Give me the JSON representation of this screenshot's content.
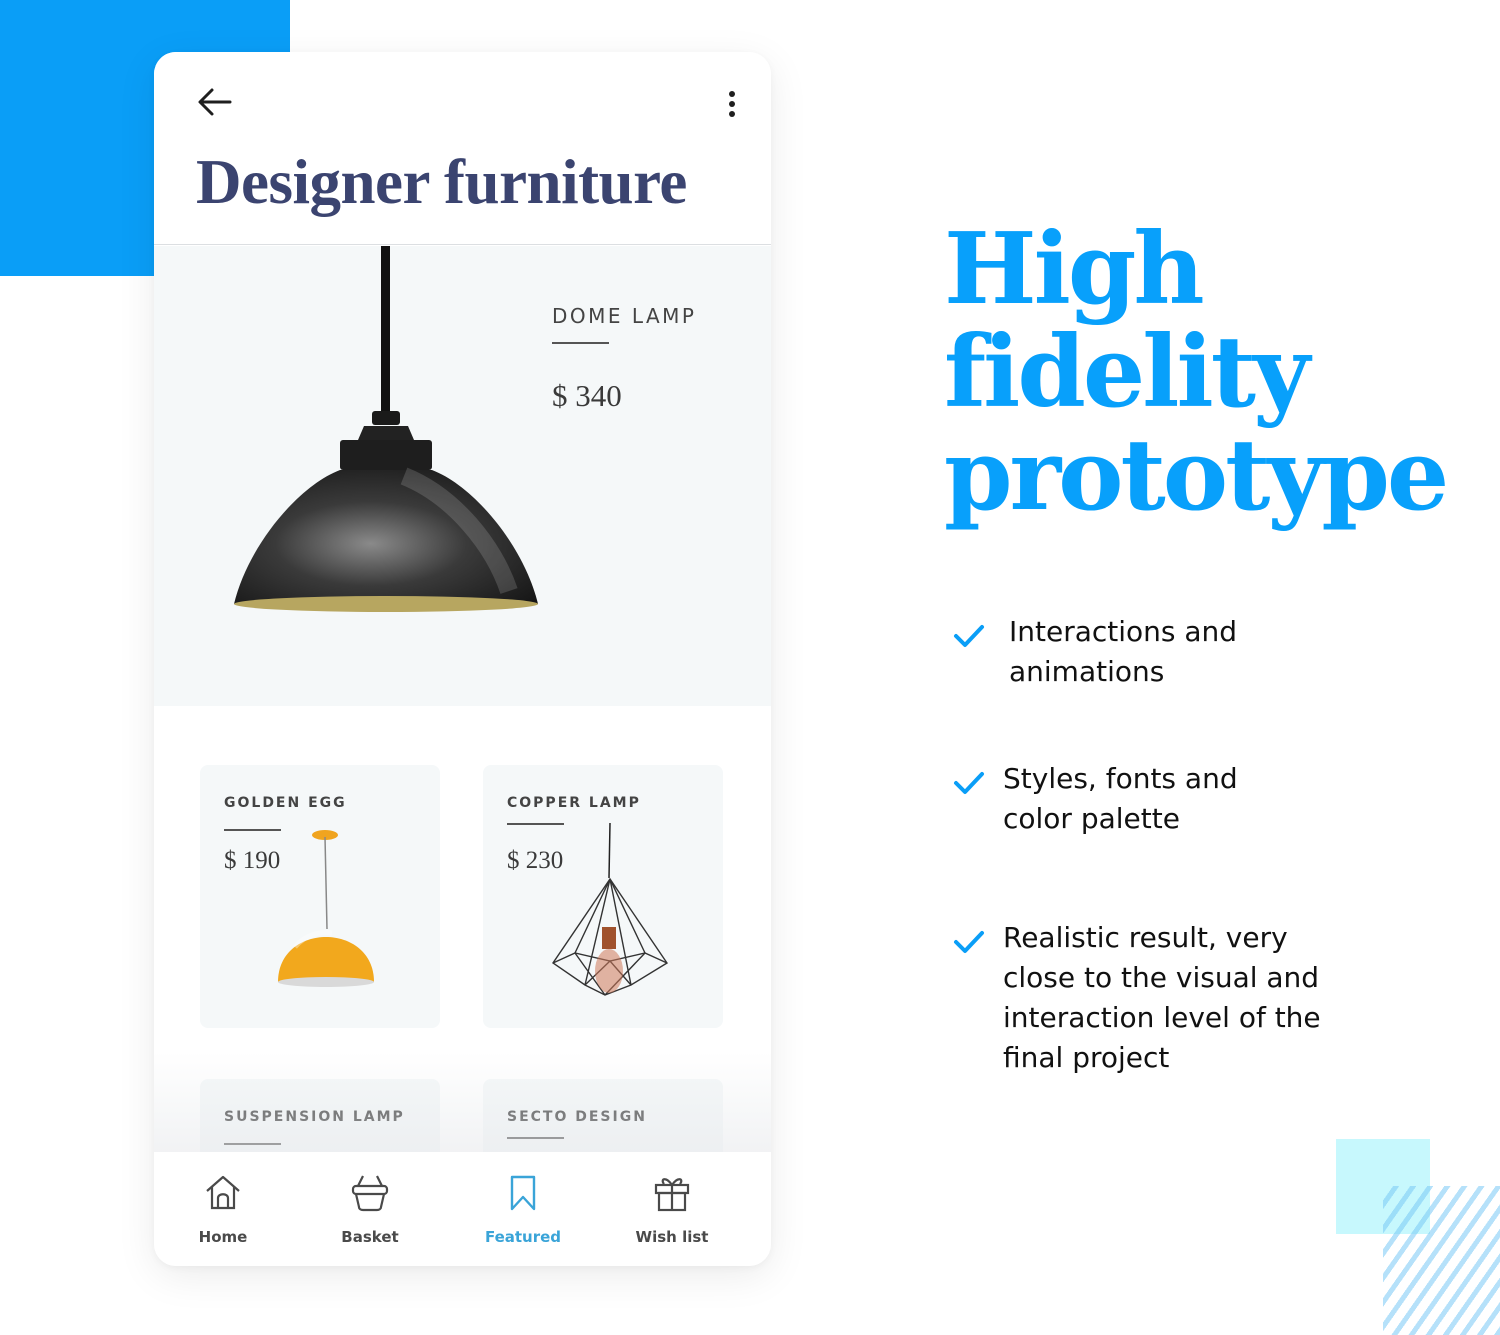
{
  "colors": {
    "accent_blue": "#0a9ef7",
    "headline_blue": "#08a0fb",
    "title_navy": "#3b4470",
    "active_tab": "#3aa4d8",
    "deco_cyan": "#c7f8fd",
    "panel_bg": "#f5f8f9"
  },
  "app": {
    "header": {
      "back_icon": "arrow-left-icon",
      "more_icon": "more-vertical-icon",
      "title": "Designer furniture"
    },
    "hero": {
      "name": "DOME LAMP",
      "price": "$ 340",
      "image": "black-dome-pendant-lamp"
    },
    "products": [
      {
        "name": "GOLDEN EGG",
        "price": "$ 190",
        "image": "yellow-dome-pendant-lamp"
      },
      {
        "name": "COPPER LAMP",
        "price": "$ 230",
        "image": "geometric-wire-cage-lamp"
      },
      {
        "name": "SUSPENSION LAMP",
        "price": null,
        "image": null
      },
      {
        "name": "SECTO DESIGN",
        "price": null,
        "image": null
      }
    ],
    "tabbar": {
      "active": "Featured",
      "tabs": [
        {
          "label": "Home",
          "icon": "home-icon"
        },
        {
          "label": "Basket",
          "icon": "basket-icon"
        },
        {
          "label": "Featured",
          "icon": "bookmark-icon"
        },
        {
          "label": "Wish list",
          "icon": "gift-icon"
        }
      ]
    }
  },
  "headline": {
    "lines": [
      "High",
      "fidelity",
      "prototype"
    ]
  },
  "features": [
    {
      "icon": "check-icon",
      "lines": [
        "Interactions and",
        "animations"
      ]
    },
    {
      "icon": "check-icon",
      "lines": [
        "Styles, fonts and",
        "color palette"
      ]
    },
    {
      "icon": "check-icon",
      "lines": [
        "Realistic result, very",
        "close to the visual and",
        "interaction level of the",
        "final project"
      ]
    }
  ]
}
